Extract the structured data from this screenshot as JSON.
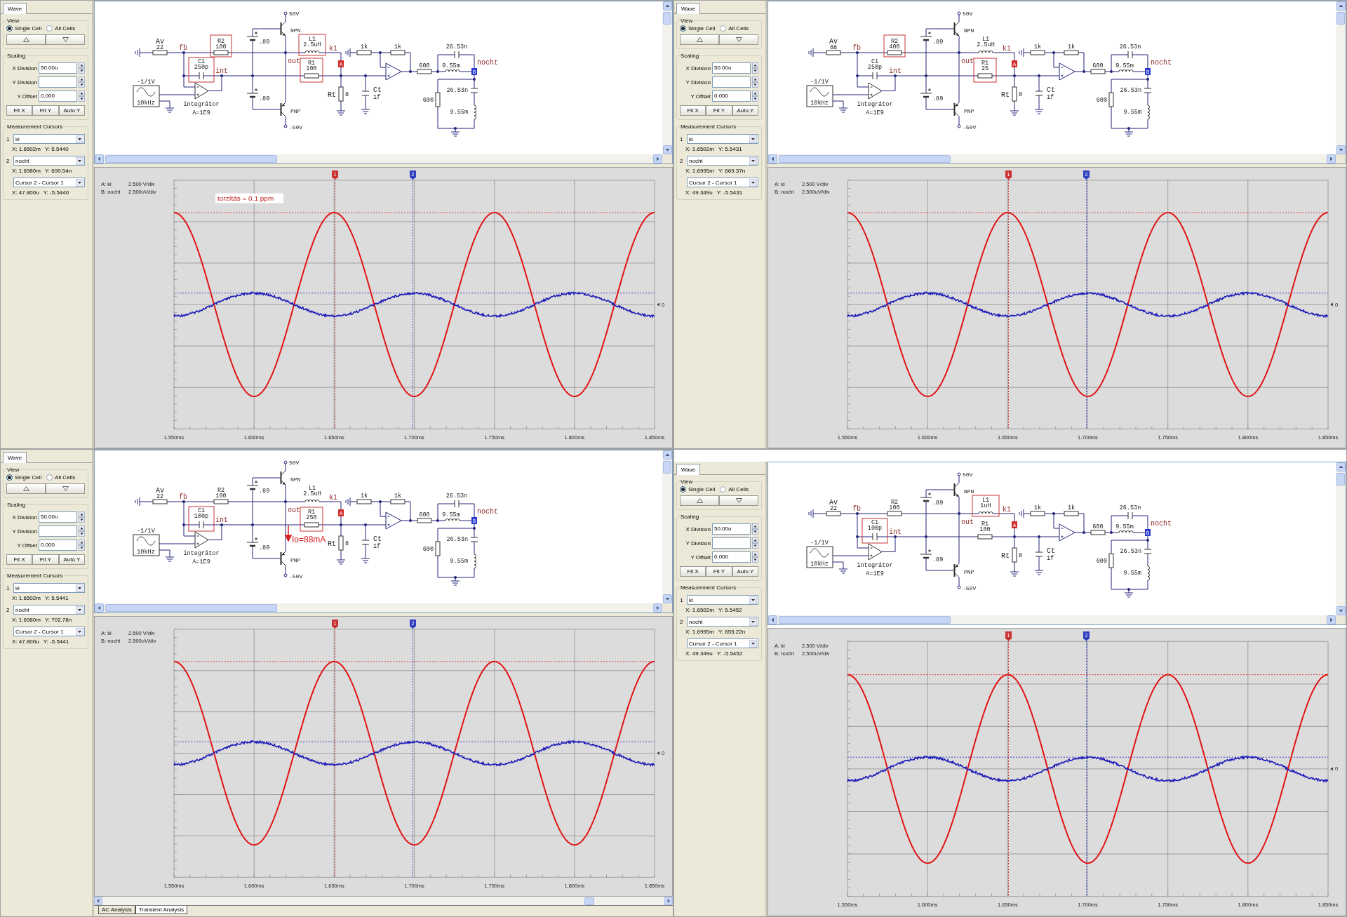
{
  "panels": [
    {
      "sidebar": {
        "tabs": [
          {
            "label": "Wave",
            "selected": true
          }
        ],
        "view": {
          "title": "View",
          "options": [
            {
              "label": "Single Cell",
              "selected": true
            },
            {
              "label": "All Cells",
              "selected": false
            }
          ]
        },
        "scaling": {
          "title": "Scaling",
          "fields": [
            {
              "label": "X Division",
              "value": "50.00u"
            },
            {
              "label": "Y Division"
            },
            {
              "label": "Y Offset",
              "value": "0.000"
            }
          ],
          "buttons": [
            "Fit X",
            "Fit Y",
            "Auto Y"
          ]
        },
        "cursors": {
          "title": "Measurement Cursors",
          "rows": [
            {
              "number": "1",
              "signal": "ki",
              "x": "X: 1.6502m",
              "y": "Y: 5.5440"
            },
            {
              "number": "2",
              "signal": "nocht",
              "x": "X: 1.6980m",
              "y": "Y: 690.54n"
            }
          ],
          "difference": {
            "mode": "Cursor 2 - Cursor 1",
            "x": "X: 47.800u",
            "y": "Y: -5.5440"
          }
        }
      },
      "schematic": {
        "components": [
          {
            "kind": "resistor",
            "name": "Av",
            "value": "22"
          },
          {
            "kind": "resistor",
            "name": "R2",
            "value": "100",
            "highlighted": true
          },
          {
            "kind": "capacitor",
            "name": "C1",
            "value": "250p",
            "highlighted": true
          },
          {
            "kind": "source",
            "amplitude": "-1/1V",
            "frequency": "10kHz"
          },
          {
            "kind": "opamp",
            "name": "integrátor",
            "gain": "A=1E9"
          },
          {
            "kind": "npn",
            "name": "NPN",
            "supply": "50V"
          },
          {
            "kind": "pnp",
            "name": "PNP",
            "supply": "-50V"
          },
          {
            "kind": "battery",
            "value": ".89"
          },
          {
            "kind": "battery",
            "value": ".89"
          },
          {
            "kind": "inductor",
            "name": "L1",
            "value": "2.5uH",
            "highlighted": true
          },
          {
            "kind": "resistor",
            "name": "R1",
            "value": "100",
            "highlighted": true
          },
          {
            "kind": "resistor",
            "name": "Rt",
            "value": "8"
          },
          {
            "kind": "capacitor",
            "name": "Ct",
            "value": "1f"
          },
          {
            "kind": "resistor",
            "value": "1k"
          },
          {
            "kind": "resistor",
            "value": "1k"
          },
          {
            "kind": "resistor",
            "value": "600"
          },
          {
            "kind": "capacitor",
            "value": "26.53n"
          },
          {
            "kind": "inductor",
            "value": "9.55m"
          },
          {
            "kind": "resistor",
            "value": "600"
          },
          {
            "kind": "capacitor",
            "value": "26.53n"
          },
          {
            "kind": "inductor",
            "value": "9.55m"
          }
        ],
        "nets": [
          "fb",
          "int",
          "out",
          "ki",
          "nocht"
        ],
        "probes": [
          {
            "label": "A",
            "color": "#d42a2a"
          },
          {
            "label": "B",
            "color": "#2a3ad0"
          }
        ]
      },
      "plot": {
        "legend": [
          {
            "channel": "A: ki",
            "scale": "2.500 V/div",
            "color": "#e01414"
          },
          {
            "channel": "B: nocht",
            "scale": "2.500uV/div",
            "color": "#1c1cb8"
          }
        ],
        "annotation": "torzítás = 0.1 ppm",
        "cursor_markers": [
          {
            "label": "1",
            "color": "#c83232"
          },
          {
            "label": "2",
            "color": "#3040c0"
          }
        ],
        "zero_label": "0",
        "x_labels": [
          "1.550ms",
          "1.600ms",
          "1.650ms",
          "1.700ms",
          "1.750ms",
          "1.800ms",
          "1.850ms"
        ]
      }
    },
    {
      "sidebar": {
        "tabs": [
          {
            "label": "Wave",
            "selected": true
          }
        ],
        "view": {
          "title": "View",
          "options": [
            {
              "label": "Single Cell",
              "selected": true
            },
            {
              "label": "All Cells",
              "selected": false
            }
          ]
        },
        "scaling": {
          "title": "Scaling",
          "fields": [
            {
              "label": "X Division",
              "value": "50.00u"
            },
            {
              "label": "Y Division"
            },
            {
              "label": "Y Offset",
              "value": "0.000"
            }
          ],
          "buttons": [
            "Fit X",
            "Fit Y",
            "Auto Y"
          ]
        },
        "cursors": {
          "title": "Measurement Cursors",
          "rows": [
            {
              "number": "1",
              "signal": "ki",
              "x": "X: 1.6502m",
              "y": "Y: 5.5431"
            },
            {
              "number": "2",
              "signal": "nocht",
              "x": "X: 1.6995m",
              "y": "Y: 669.37n"
            }
          ],
          "difference": {
            "mode": "Cursor 2 - Cursor 1",
            "x": "X: 49.349u",
            "y": "Y: -5.5431"
          }
        }
      },
      "schematic": {
        "components": [
          {
            "kind": "resistor",
            "name": "Av",
            "value": "88"
          },
          {
            "kind": "resistor",
            "name": "R2",
            "value": "400",
            "highlighted": true
          },
          {
            "kind": "capacitor",
            "name": "C1",
            "value": "250p",
            "highlighted": false
          },
          {
            "kind": "source",
            "amplitude": "-1/1V",
            "frequency": "10kHz"
          },
          {
            "kind": "opamp",
            "name": "integrátor",
            "gain": "A=1E9"
          },
          {
            "kind": "npn",
            "name": "NPN",
            "supply": "50V"
          },
          {
            "kind": "pnp",
            "name": "PNP",
            "supply": "-50V"
          },
          {
            "kind": "battery",
            "value": ".89"
          },
          {
            "kind": "battery",
            "value": ".89"
          },
          {
            "kind": "inductor",
            "name": "L1",
            "value": "2.5uH",
            "highlighted": false
          },
          {
            "kind": "resistor",
            "name": "R1",
            "value": "25",
            "highlighted": true
          },
          {
            "kind": "resistor",
            "name": "Rt",
            "value": "8"
          },
          {
            "kind": "capacitor",
            "name": "Ct",
            "value": "1f"
          },
          {
            "kind": "resistor",
            "value": "1k"
          },
          {
            "kind": "resistor",
            "value": "1k"
          },
          {
            "kind": "resistor",
            "value": "600"
          },
          {
            "kind": "capacitor",
            "value": "26.53n"
          },
          {
            "kind": "inductor",
            "value": "9.55m"
          },
          {
            "kind": "resistor",
            "value": "600"
          },
          {
            "kind": "capacitor",
            "value": "26.53n"
          },
          {
            "kind": "inductor",
            "value": "9.55m"
          }
        ],
        "nets": [
          "fb",
          "int",
          "out",
          "ki",
          "nocht"
        ],
        "probes": [
          {
            "label": "A",
            "color": "#d42a2a"
          },
          {
            "label": "B",
            "color": "#2a3ad0"
          }
        ]
      },
      "plot": {
        "legend": [
          {
            "channel": "A: ki",
            "scale": "2.500 V/div",
            "color": "#e01414"
          },
          {
            "channel": "B: nocht",
            "scale": "2.500uV/div",
            "color": "#1c1cb8"
          }
        ],
        "cursor_markers": [
          {
            "label": "1",
            "color": "#c83232"
          },
          {
            "label": "2",
            "color": "#3040c0"
          }
        ],
        "zero_label": "0",
        "x_labels": [
          "1.550ms",
          "1.600ms",
          "1.650ms",
          "1.700ms",
          "1.750ms",
          "1.800ms",
          "1.850ms"
        ]
      }
    },
    {
      "sidebar": {
        "tabs": [
          {
            "label": "Wave",
            "selected": true
          }
        ],
        "view": {
          "title": "View",
          "options": [
            {
              "label": "Single Cell",
              "selected": true
            },
            {
              "label": "All Cells",
              "selected": false
            }
          ]
        },
        "scaling": {
          "title": "Scaling",
          "fields": [
            {
              "label": "X Division",
              "value": "50.00u"
            },
            {
              "label": "Y Division"
            },
            {
              "label": "Y Offset",
              "value": "0.000"
            }
          ],
          "buttons": [
            "Fit X",
            "Fit Y",
            "Auto Y"
          ]
        },
        "cursors": {
          "title": "Measurement Cursors",
          "rows": [
            {
              "number": "1",
              "signal": "ki",
              "x": "X: 1.6502m",
              "y": "Y: 5.5441"
            },
            {
              "number": "2",
              "signal": "nocht",
              "x": "X: 1.6980m",
              "y": "Y: 702.78n"
            }
          ],
          "difference": {
            "mode": "Cursor 2 - Cursor 1",
            "x": "X: 47.800u",
            "y": "Y: -5.5441"
          }
        }
      },
      "schematic": {
        "components": [
          {
            "kind": "resistor",
            "name": "Av",
            "value": "22"
          },
          {
            "kind": "resistor",
            "name": "R2",
            "value": "100",
            "highlighted": false
          },
          {
            "kind": "capacitor",
            "name": "C1",
            "value": "100p",
            "highlighted": true
          },
          {
            "kind": "source",
            "amplitude": "-1/1V",
            "frequency": "10kHz"
          },
          {
            "kind": "opamp",
            "name": "integrátor",
            "gain": "A=1E9"
          },
          {
            "kind": "npn",
            "name": "NPN",
            "supply": "50V"
          },
          {
            "kind": "pnp",
            "name": "PNP",
            "supply": "-50V"
          },
          {
            "kind": "battery",
            "value": ".89"
          },
          {
            "kind": "battery",
            "value": ".89"
          },
          {
            "kind": "inductor",
            "name": "L1",
            "value": "2.5uH",
            "highlighted": false
          },
          {
            "kind": "resistor",
            "name": "R1",
            "value": "250",
            "highlighted": true
          },
          {
            "kind": "resistor",
            "name": "Rt",
            "value": "8"
          },
          {
            "kind": "capacitor",
            "name": "Ct",
            "value": "1f"
          },
          {
            "kind": "resistor",
            "value": "1k"
          },
          {
            "kind": "resistor",
            "value": "1k"
          },
          {
            "kind": "resistor",
            "value": "600"
          },
          {
            "kind": "capacitor",
            "value": "26.53n"
          },
          {
            "kind": "inductor",
            "value": "9.55m"
          },
          {
            "kind": "resistor",
            "value": "600"
          },
          {
            "kind": "capacitor",
            "value": "26.53n"
          },
          {
            "kind": "inductor",
            "value": "9.55m"
          }
        ],
        "nets": [
          "fb",
          "int",
          "out",
          "ki",
          "nocht"
        ],
        "probes": [
          {
            "label": "A",
            "color": "#d42a2a"
          },
          {
            "label": "B",
            "color": "#2a3ad0"
          }
        ],
        "annotation": "Io=88mA"
      },
      "plot": {
        "legend": [
          {
            "channel": "A: ki",
            "scale": "2.500 V/div",
            "color": "#e01414"
          },
          {
            "channel": "B: nocht",
            "scale": "2.500uV/div",
            "color": "#1c1cb8"
          }
        ],
        "cursor_markers": [
          {
            "label": "1",
            "color": "#c83232"
          },
          {
            "label": "2",
            "color": "#3040c0"
          }
        ],
        "zero_label": "0",
        "x_labels": [
          "1.550ms",
          "1.600ms",
          "1.650ms",
          "1.700ms",
          "1.750ms",
          "1.800ms",
          "1.850ms"
        ]
      },
      "analysis_tabs": [
        {
          "label": "AC Analysis",
          "selected": false
        },
        {
          "label": "Transient Analysis",
          "selected": true
        }
      ]
    },
    {
      "sidebar": {
        "tabs": [
          {
            "label": "Wave",
            "selected": true
          }
        ],
        "view": {
          "title": "View",
          "options": [
            {
              "label": "Single Cell",
              "selected": true
            },
            {
              "label": "All Cells",
              "selected": false
            }
          ]
        },
        "scaling": {
          "title": "Scaling",
          "fields": [
            {
              "label": "X Division",
              "value": "50.00u"
            },
            {
              "label": "Y Division"
            },
            {
              "label": "Y Offset",
              "value": "0.000"
            }
          ],
          "buttons": [
            "Fit X",
            "Fit Y",
            "Auto Y"
          ]
        },
        "cursors": {
          "title": "Measurement Cursors",
          "rows": [
            {
              "number": "1",
              "signal": "ki",
              "x": "X: 1.6502m",
              "y": "Y: 5.5452"
            },
            {
              "number": "2",
              "signal": "nocht",
              "x": "X: 1.6995m",
              "y": "Y: 655.22n"
            }
          ],
          "difference": {
            "mode": "Cursor 2 - Cursor 1",
            "x": "X: 49.349u",
            "y": "Y: -5.5452"
          }
        }
      },
      "schematic": {
        "components": [
          {
            "kind": "resistor",
            "name": "Av",
            "value": "22"
          },
          {
            "kind": "resistor",
            "name": "R2",
            "value": "100",
            "highlighted": false
          },
          {
            "kind": "capacitor",
            "name": "C1",
            "value": "100p",
            "highlighted": true
          },
          {
            "kind": "source",
            "amplitude": "-1/1V",
            "frequency": "10kHz"
          },
          {
            "kind": "opamp",
            "name": "integrátor",
            "gain": "A=1E9"
          },
          {
            "kind": "npn",
            "name": "NPN",
            "supply": "50V"
          },
          {
            "kind": "pnp",
            "name": "PNP",
            "supply": "-50V"
          },
          {
            "kind": "battery",
            "value": ".89"
          },
          {
            "kind": "battery",
            "value": ".89"
          },
          {
            "kind": "inductor",
            "name": "L1",
            "value": "1uH",
            "highlighted": true
          },
          {
            "kind": "resistor",
            "name": "R1",
            "value": "100",
            "highlighted": false
          },
          {
            "kind": "resistor",
            "name": "Rt",
            "value": "8"
          },
          {
            "kind": "capacitor",
            "name": "Ct",
            "value": "1f"
          },
          {
            "kind": "resistor",
            "value": "1k"
          },
          {
            "kind": "resistor",
            "value": "1k"
          },
          {
            "kind": "resistor",
            "value": "600"
          },
          {
            "kind": "capacitor",
            "value": "26.53n"
          },
          {
            "kind": "inductor",
            "value": "9.55m"
          },
          {
            "kind": "resistor",
            "value": "600"
          },
          {
            "kind": "capacitor",
            "value": "26.53n"
          },
          {
            "kind": "inductor",
            "value": "9.55m"
          }
        ],
        "nets": [
          "fb",
          "int",
          "out",
          "ki",
          "nocht"
        ],
        "probes": [
          {
            "label": "A",
            "color": "#d42a2a"
          },
          {
            "label": "B",
            "color": "#2a3ad0"
          }
        ]
      },
      "plot": {
        "legend": [
          {
            "channel": "A: ki",
            "scale": "2.500 V/div",
            "color": "#e01414"
          },
          {
            "channel": "B: nocht",
            "scale": "2.500uV/div",
            "color": "#1c1cb8"
          }
        ],
        "cursor_markers": [
          {
            "label": "1",
            "color": "#c83232"
          },
          {
            "label": "2",
            "color": "#3040c0"
          }
        ],
        "zero_label": "0",
        "x_labels": [
          "1.550ms",
          "1.600ms",
          "1.650ms",
          "1.700ms",
          "1.750ms",
          "1.800ms",
          "1.850ms"
        ]
      }
    }
  ]
}
